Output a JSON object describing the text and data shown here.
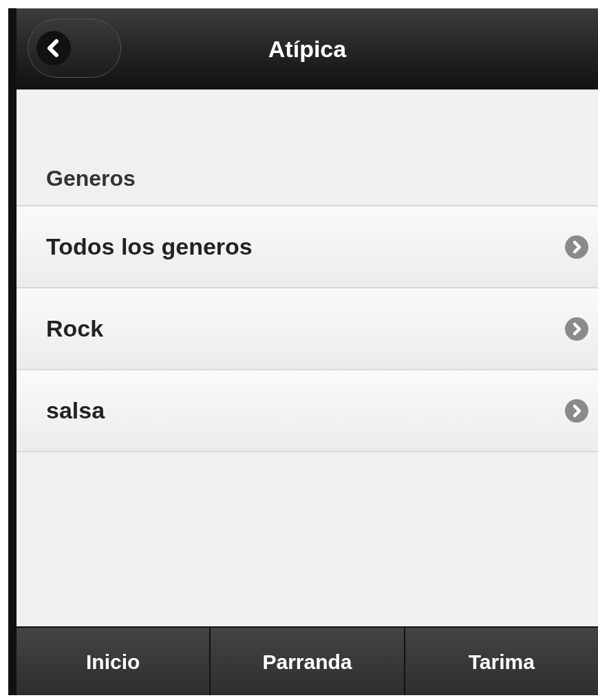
{
  "header": {
    "title": "Atípica"
  },
  "list": {
    "heading": "Generos",
    "items": [
      {
        "label": "Todos los generos"
      },
      {
        "label": "Rock"
      },
      {
        "label": "salsa"
      }
    ]
  },
  "footer": {
    "tabs": [
      {
        "label": "Inicio"
      },
      {
        "label": "Parranda"
      },
      {
        "label": "Tarima"
      }
    ]
  }
}
